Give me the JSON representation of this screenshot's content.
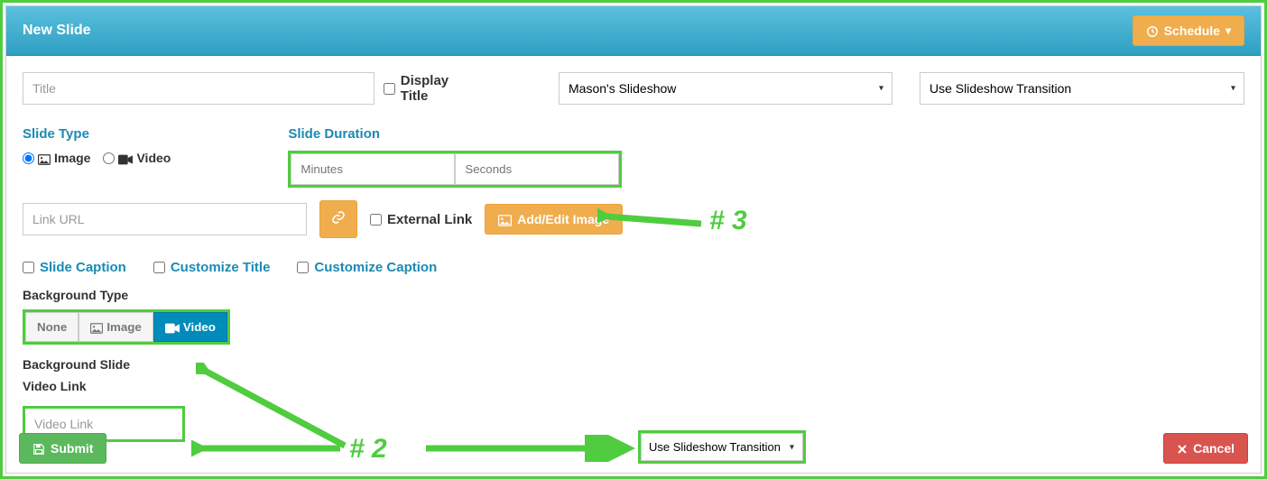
{
  "header": {
    "title": "New Slide",
    "schedule": "Schedule"
  },
  "form": {
    "title_placeholder": "Title",
    "display_title": "Display Title",
    "slideshow_selected": "Mason's Slideshow",
    "transition_selected": "Use Slideshow Transition"
  },
  "slide_type": {
    "label": "Slide Type",
    "image": "Image",
    "video": "Video"
  },
  "duration": {
    "label": "Slide Duration",
    "minutes_placeholder": "Minutes",
    "seconds_placeholder": "Seconds"
  },
  "link": {
    "url_placeholder": "Link URL",
    "external": "External Link",
    "add_edit": "Add/Edit Image"
  },
  "captions": {
    "slide_caption": "Slide Caption",
    "customize_title": "Customize Title",
    "customize_caption": "Customize Caption"
  },
  "background": {
    "type_label": "Background Type",
    "none": "None",
    "image": "Image",
    "video": "Video",
    "slide_label": "Background Slide",
    "video_link_label": "Video Link",
    "video_link_placeholder": "Video Link",
    "transition2_selected": "Use Slideshow Transition"
  },
  "footer": {
    "submit": "Submit",
    "cancel": "Cancel"
  },
  "annotations": {
    "n2": "# 2",
    "n3": "# 3"
  }
}
